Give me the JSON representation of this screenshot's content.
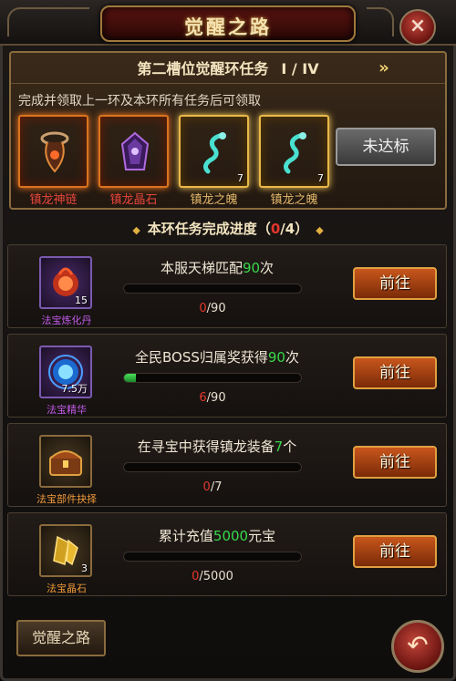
{
  "header": {
    "title": "觉醒之路",
    "close_icon": "×"
  },
  "ring": {
    "title": "第二槽位觉醒环任务",
    "stage": "I / IV",
    "next_icon": "»",
    "unlock_hint": "完成并领取上一环及本环所有任务后可领取",
    "status_button": "未达标",
    "rewards": [
      {
        "name": "镇龙神链",
        "count": "",
        "rarity": "red"
      },
      {
        "name": "镇龙晶石",
        "count": "",
        "rarity": "red"
      },
      {
        "name": "镇龙之魄",
        "count": "7",
        "rarity": "gold"
      },
      {
        "name": "镇龙之魄",
        "count": "7",
        "rarity": "gold"
      }
    ]
  },
  "progress": {
    "label": "本环任务完成进度",
    "current": "0",
    "total": "4",
    "open": "（",
    "slash": "/",
    "close": "）"
  },
  "tasks": [
    {
      "item_name": "法宝炼化丹",
      "item_amount": "15",
      "desc_pre": "本服天梯匹配",
      "desc_num": "90",
      "desc_post": "次",
      "current": "0",
      "total": "/90",
      "progress": 0,
      "button": "前往"
    },
    {
      "item_name": "法宝精华",
      "item_amount": "7.5万",
      "desc_pre": "全民BOSS归属奖获得",
      "desc_num": "90",
      "desc_post": "次",
      "current": "6",
      "total": "/90",
      "progress": 0.067,
      "button": "前往"
    },
    {
      "item_name": "法宝部件抉择",
      "item_amount": "",
      "desc_pre": "在寻宝中获得镇龙装备",
      "desc_num": "7",
      "desc_post": "个",
      "current": "0",
      "total": "/7",
      "progress": 0,
      "button": "前往"
    },
    {
      "item_name": "法宝晶石",
      "item_amount": "3",
      "desc_pre": "累计充值",
      "desc_num": "5000",
      "desc_post": "元宝",
      "current": "0",
      "total": "/5000",
      "progress": 0,
      "button": "前往"
    }
  ],
  "footer": {
    "tab_label": "觉醒之路",
    "back_icon": "↶"
  }
}
